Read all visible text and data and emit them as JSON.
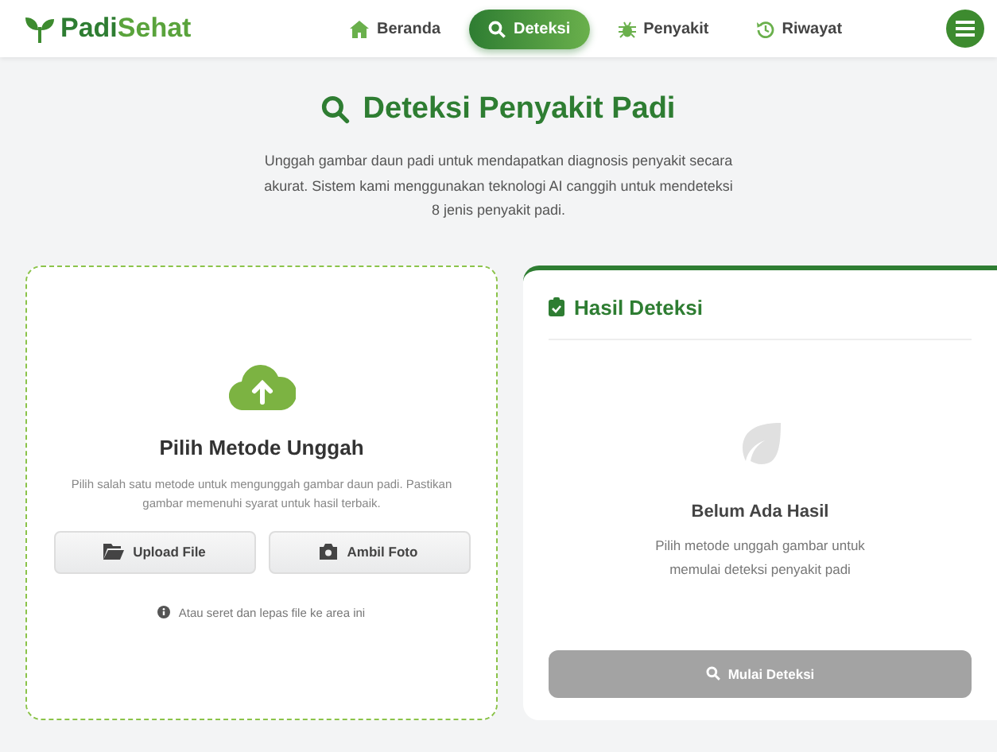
{
  "brand": {
    "primary": "Padi",
    "accent": "Sehat"
  },
  "nav": [
    {
      "label": "Beranda",
      "selected": false
    },
    {
      "label": "Deteksi",
      "selected": true
    },
    {
      "label": "Penyakit",
      "selected": false
    },
    {
      "label": "Riwayat",
      "selected": false
    }
  ],
  "page": {
    "title": "Deteksi Penyakit Padi",
    "description": "Unggah gambar daun padi untuk mendapatkan diagnosis penyakit secara akurat. Sistem kami menggunakan teknologi AI canggih untuk mendeteksi 8 jenis penyakit padi."
  },
  "upload": {
    "title": "Pilih Metode Unggah",
    "description": "Pilih salah satu metode untuk mengunggah gambar daun padi. Pastikan gambar memenuhi syarat untuk hasil terbaik.",
    "buttons": [
      {
        "label": "Upload File"
      },
      {
        "label": "Ambil Foto"
      }
    ],
    "hint": "Atau seret dan lepas file ke area ini"
  },
  "result": {
    "title": "Hasil Deteksi",
    "empty_title": "Belum Ada Hasil",
    "empty_text": "Pilih metode unggah gambar untuk memulai deteksi penyakit padi",
    "button": {
      "label": "Mulai Deteksi",
      "disabled": true
    }
  }
}
